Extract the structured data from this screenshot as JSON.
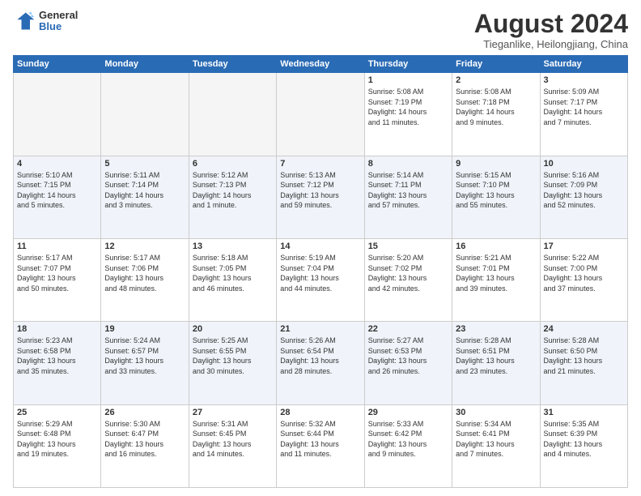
{
  "logo": {
    "general": "General",
    "blue": "Blue"
  },
  "title": "August 2024",
  "location": "Tieganlike, Heilongjiang, China",
  "days_header": [
    "Sunday",
    "Monday",
    "Tuesday",
    "Wednesday",
    "Thursday",
    "Friday",
    "Saturday"
  ],
  "weeks": [
    [
      {
        "day": "",
        "info": ""
      },
      {
        "day": "",
        "info": ""
      },
      {
        "day": "",
        "info": ""
      },
      {
        "day": "",
        "info": ""
      },
      {
        "day": "1",
        "info": "Sunrise: 5:08 AM\nSunset: 7:19 PM\nDaylight: 14 hours\nand 11 minutes."
      },
      {
        "day": "2",
        "info": "Sunrise: 5:08 AM\nSunset: 7:18 PM\nDaylight: 14 hours\nand 9 minutes."
      },
      {
        "day": "3",
        "info": "Sunrise: 5:09 AM\nSunset: 7:17 PM\nDaylight: 14 hours\nand 7 minutes."
      }
    ],
    [
      {
        "day": "4",
        "info": "Sunrise: 5:10 AM\nSunset: 7:15 PM\nDaylight: 14 hours\nand 5 minutes."
      },
      {
        "day": "5",
        "info": "Sunrise: 5:11 AM\nSunset: 7:14 PM\nDaylight: 14 hours\nand 3 minutes."
      },
      {
        "day": "6",
        "info": "Sunrise: 5:12 AM\nSunset: 7:13 PM\nDaylight: 14 hours\nand 1 minute."
      },
      {
        "day": "7",
        "info": "Sunrise: 5:13 AM\nSunset: 7:12 PM\nDaylight: 13 hours\nand 59 minutes."
      },
      {
        "day": "8",
        "info": "Sunrise: 5:14 AM\nSunset: 7:11 PM\nDaylight: 13 hours\nand 57 minutes."
      },
      {
        "day": "9",
        "info": "Sunrise: 5:15 AM\nSunset: 7:10 PM\nDaylight: 13 hours\nand 55 minutes."
      },
      {
        "day": "10",
        "info": "Sunrise: 5:16 AM\nSunset: 7:09 PM\nDaylight: 13 hours\nand 52 minutes."
      }
    ],
    [
      {
        "day": "11",
        "info": "Sunrise: 5:17 AM\nSunset: 7:07 PM\nDaylight: 13 hours\nand 50 minutes."
      },
      {
        "day": "12",
        "info": "Sunrise: 5:17 AM\nSunset: 7:06 PM\nDaylight: 13 hours\nand 48 minutes."
      },
      {
        "day": "13",
        "info": "Sunrise: 5:18 AM\nSunset: 7:05 PM\nDaylight: 13 hours\nand 46 minutes."
      },
      {
        "day": "14",
        "info": "Sunrise: 5:19 AM\nSunset: 7:04 PM\nDaylight: 13 hours\nand 44 minutes."
      },
      {
        "day": "15",
        "info": "Sunrise: 5:20 AM\nSunset: 7:02 PM\nDaylight: 13 hours\nand 42 minutes."
      },
      {
        "day": "16",
        "info": "Sunrise: 5:21 AM\nSunset: 7:01 PM\nDaylight: 13 hours\nand 39 minutes."
      },
      {
        "day": "17",
        "info": "Sunrise: 5:22 AM\nSunset: 7:00 PM\nDaylight: 13 hours\nand 37 minutes."
      }
    ],
    [
      {
        "day": "18",
        "info": "Sunrise: 5:23 AM\nSunset: 6:58 PM\nDaylight: 13 hours\nand 35 minutes."
      },
      {
        "day": "19",
        "info": "Sunrise: 5:24 AM\nSunset: 6:57 PM\nDaylight: 13 hours\nand 33 minutes."
      },
      {
        "day": "20",
        "info": "Sunrise: 5:25 AM\nSunset: 6:55 PM\nDaylight: 13 hours\nand 30 minutes."
      },
      {
        "day": "21",
        "info": "Sunrise: 5:26 AM\nSunset: 6:54 PM\nDaylight: 13 hours\nand 28 minutes."
      },
      {
        "day": "22",
        "info": "Sunrise: 5:27 AM\nSunset: 6:53 PM\nDaylight: 13 hours\nand 26 minutes."
      },
      {
        "day": "23",
        "info": "Sunrise: 5:28 AM\nSunset: 6:51 PM\nDaylight: 13 hours\nand 23 minutes."
      },
      {
        "day": "24",
        "info": "Sunrise: 5:28 AM\nSunset: 6:50 PM\nDaylight: 13 hours\nand 21 minutes."
      }
    ],
    [
      {
        "day": "25",
        "info": "Sunrise: 5:29 AM\nSunset: 6:48 PM\nDaylight: 13 hours\nand 19 minutes."
      },
      {
        "day": "26",
        "info": "Sunrise: 5:30 AM\nSunset: 6:47 PM\nDaylight: 13 hours\nand 16 minutes."
      },
      {
        "day": "27",
        "info": "Sunrise: 5:31 AM\nSunset: 6:45 PM\nDaylight: 13 hours\nand 14 minutes."
      },
      {
        "day": "28",
        "info": "Sunrise: 5:32 AM\nSunset: 6:44 PM\nDaylight: 13 hours\nand 11 minutes."
      },
      {
        "day": "29",
        "info": "Sunrise: 5:33 AM\nSunset: 6:42 PM\nDaylight: 13 hours\nand 9 minutes."
      },
      {
        "day": "30",
        "info": "Sunrise: 5:34 AM\nSunset: 6:41 PM\nDaylight: 13 hours\nand 7 minutes."
      },
      {
        "day": "31",
        "info": "Sunrise: 5:35 AM\nSunset: 6:39 PM\nDaylight: 13 hours\nand 4 minutes."
      }
    ]
  ]
}
